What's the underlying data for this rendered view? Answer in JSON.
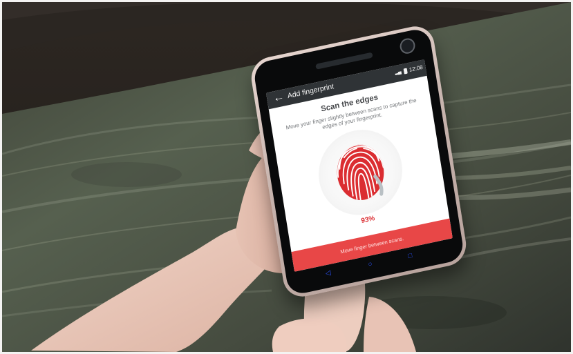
{
  "screen": {
    "title": "Add fingerprint",
    "back_icon": "arrow-left-icon",
    "status": {
      "time": "12:08",
      "signal_icon": "signal-icon",
      "battery_icon": "battery-icon"
    },
    "instruction_title": "Scan the edges",
    "instruction_text": "Move your finger slightly between scans to capture the edges of your fingerprint.",
    "fingerprint_icon": "fingerprint-icon",
    "progress_text": "93%",
    "progress": 0.93,
    "banner_text": "Move finger between scans."
  },
  "device": {
    "nav_icons": [
      "back-icon",
      "home-icon",
      "recent-apps-icon"
    ]
  },
  "colors": {
    "accent_red": "#e84747",
    "fingerprint_red": "#db2d31",
    "appbar_dark": "#2f3336",
    "table_wood": "#4f5a48",
    "phone_finish": "#c7b4ae"
  }
}
